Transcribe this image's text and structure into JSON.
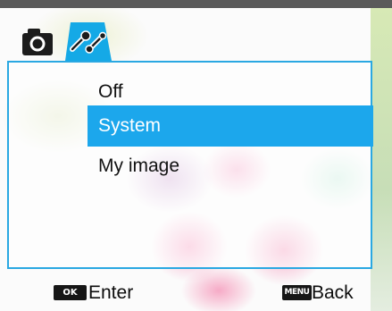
{
  "tabs": [
    {
      "icon": "camera-icon"
    },
    {
      "icon": "setup-tools-icon",
      "active": true
    }
  ],
  "menu": {
    "items": [
      "Off",
      "System",
      "My image"
    ],
    "selected_index": 1
  },
  "footer": {
    "ok_key": "OK",
    "enter_label": "Enter",
    "menu_key": "MENU",
    "back_label": "Back"
  },
  "colors": {
    "accent": "#1ca7ec",
    "top_bar": "#5a5a5a",
    "key_bg": "#161616"
  }
}
